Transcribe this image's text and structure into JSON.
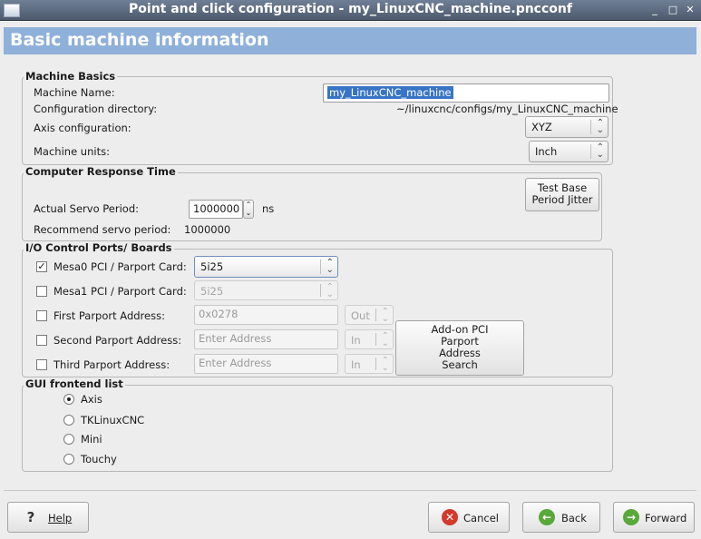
{
  "window": {
    "title": "Point and click configuration - my_LinuxCNC_machine.pncconf"
  },
  "header": {
    "title": "Basic machine information"
  },
  "machine_basics": {
    "legend": "Machine Basics",
    "name_label": "Machine Name:",
    "name_value": "my_LinuxCNC_machine",
    "dir_label": "Configuration directory:",
    "dir_value": "~/linuxcnc/configs/my_LinuxCNC_machine",
    "axis_label": "Axis configuration:",
    "axis_value": "XYZ",
    "units_label": "Machine units:",
    "units_value": "Inch"
  },
  "response": {
    "legend": "Computer Response Time",
    "servo_label": "Actual Servo Period:",
    "servo_value": "1000000",
    "servo_unit": "ns",
    "recommend_label": "Recommend servo period:",
    "recommend_value": "1000000",
    "test_button_line1": "Test Base",
    "test_button_line2": "Period Jitter"
  },
  "io": {
    "legend": "I/O Control Ports/ Boards",
    "mesa0_label": "Mesa0 PCI / Parport Card:",
    "mesa0_value": "5i25",
    "mesa0_checked": true,
    "mesa1_label": "Mesa1 PCI / Parport Card:",
    "mesa1_value": "5i25",
    "first_label": "First Parport Address:",
    "first_value": "0x0278",
    "first_dir": "Out",
    "second_label": "Second Parport Address:",
    "second_placeholder": "Enter Address",
    "second_dir": "In",
    "third_label": "Third Parport Address:",
    "third_placeholder": "Enter Address",
    "third_dir": "In",
    "addon_line1": "Add-on PCI",
    "addon_line2": "Parport",
    "addon_line3": "Address",
    "addon_line4": "Search"
  },
  "gui": {
    "legend": "GUI frontend list",
    "options": [
      "Axis",
      "TKLinuxCNC",
      "Mini",
      "Touchy"
    ],
    "selected": "Axis"
  },
  "footer": {
    "help": "Help",
    "cancel": "Cancel",
    "back": "Back",
    "forward": "Forward"
  },
  "colors": {
    "header_bg": "#8fb0d9",
    "selection": "#3874c5",
    "titlebar": "#5a6679"
  }
}
